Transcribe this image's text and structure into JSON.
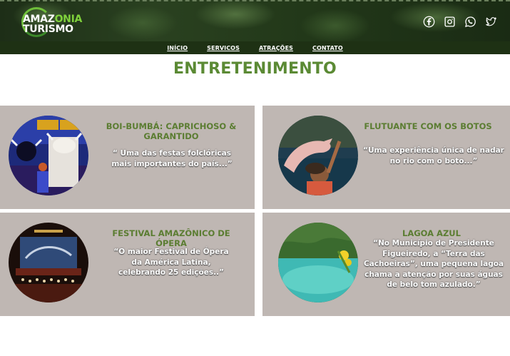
{
  "brand": {
    "line1_a": "AMAZ",
    "line1_b": "ONIA",
    "line2": "TURISMO"
  },
  "social_icons": [
    "facebook-icon",
    "instagram-icon",
    "whatsapp-icon",
    "twitter-icon"
  ],
  "nav": {
    "items": [
      "INÍCIO",
      "SERVICOS",
      "ATRAÇÕES",
      "CONTATO"
    ]
  },
  "page": {
    "title": "ENTRETENIMENTO"
  },
  "cards": [
    {
      "title": "BOI-BUMBÁ: CAPRICHOSO & GARANTIDO",
      "description": "“ Uma das festas folclóricas mais importantes do país...”"
    },
    {
      "title": "FLUTUANTE COM OS BOTOS",
      "description": "“Uma experiência única de nadar no rio com o boto...”"
    },
    {
      "title": "FESTIVAL AMAZÔNICO DE ÓPERA",
      "description": "“O maior Festival de Ópera da América Latina, celebrando 25 edições..”"
    },
    {
      "title": "LAGOA AZUL",
      "description": "“No Município de Presidente Figueiredo, a “Terra das Cachoeiras”, uma pequena lagoa chama a atenção por suas águas de belo tom azulado.”"
    }
  ],
  "colors": {
    "accent_green": "#5b8a34",
    "card_bg": "#bfb7b3",
    "nav_bg": "#1e3114"
  }
}
